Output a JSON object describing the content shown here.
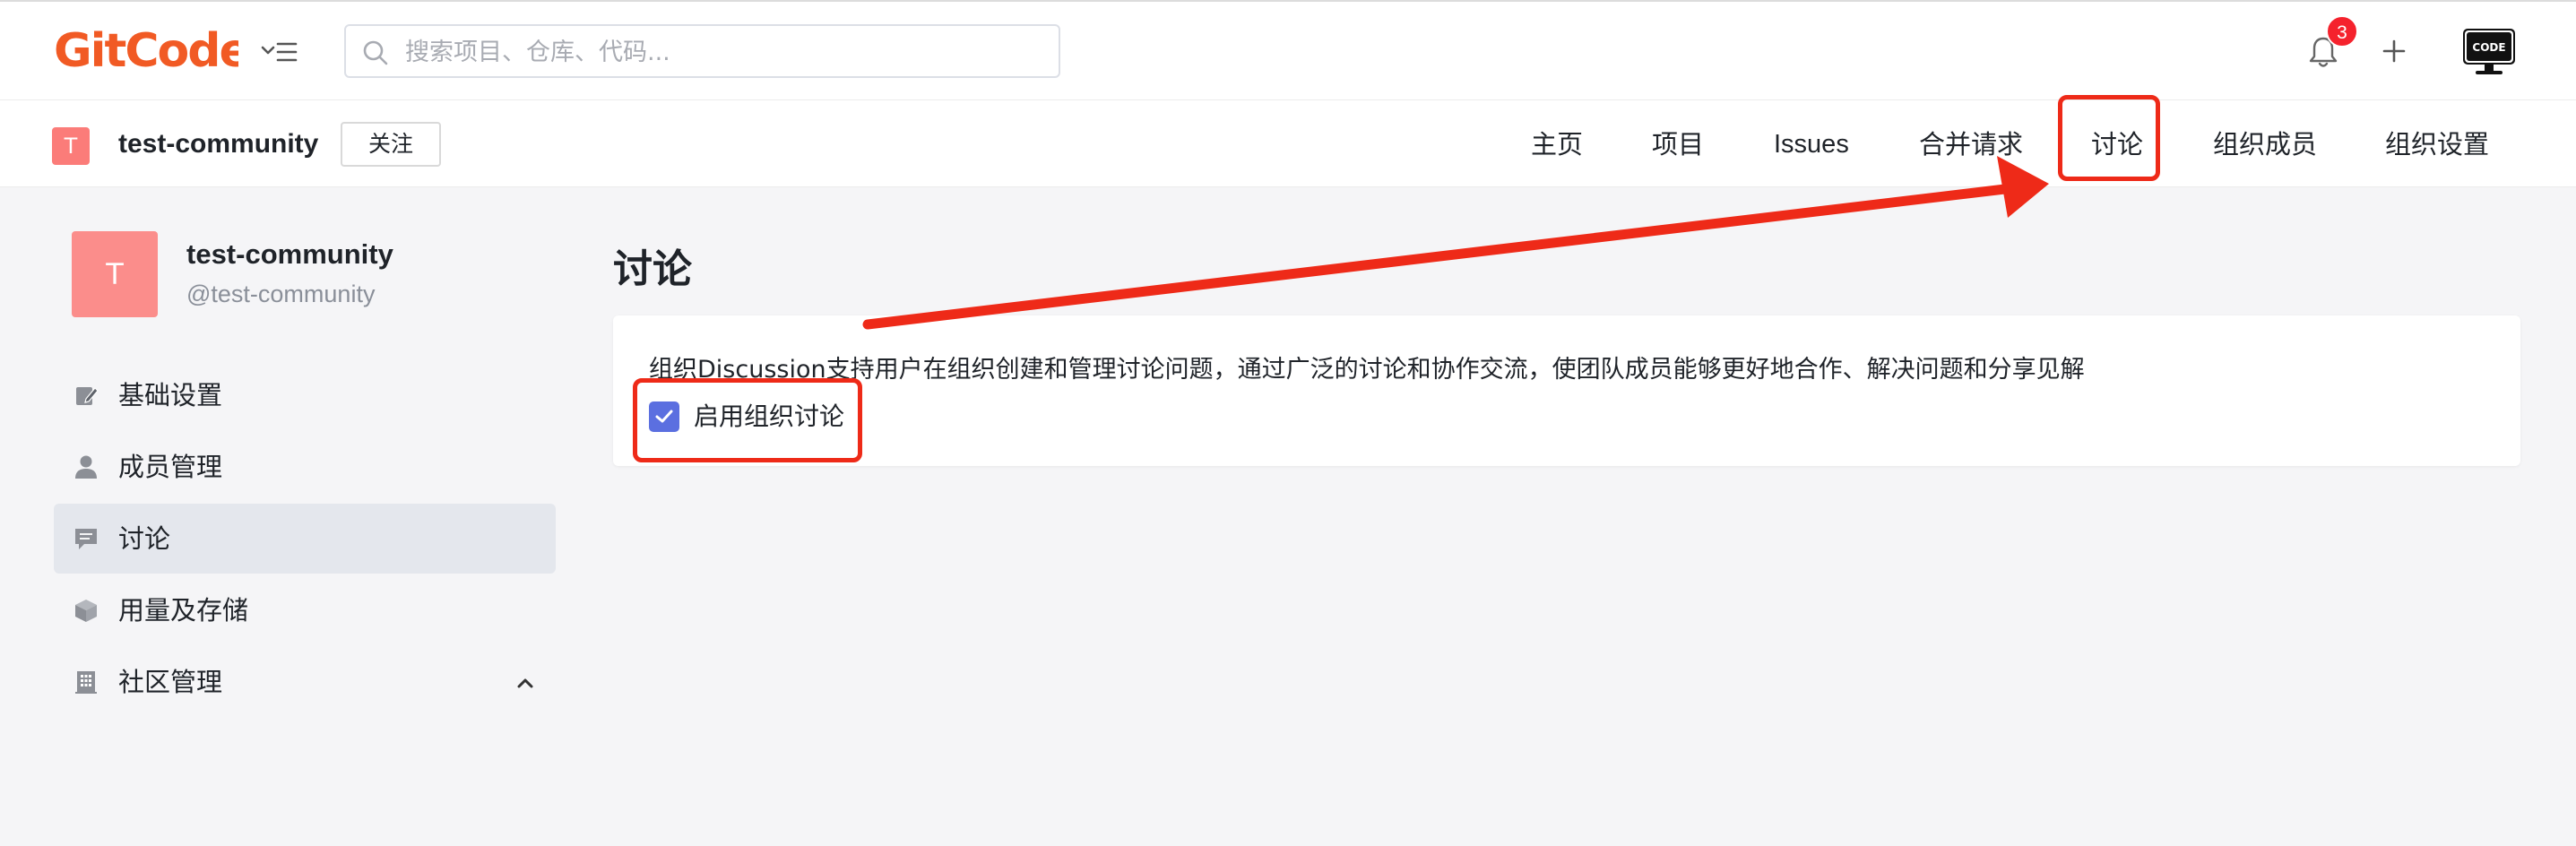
{
  "header": {
    "logo_text": "GitCode",
    "search": {
      "placeholder": "搜索项目、仓库、代码..."
    },
    "notifications": {
      "count": "3"
    },
    "avatar_text": "CODE"
  },
  "org_bar": {
    "badge_letter": "T",
    "name": "test-community",
    "follow_label": "关注",
    "tabs": [
      {
        "label": "主页"
      },
      {
        "label": "项目"
      },
      {
        "label": "Issues"
      },
      {
        "label": "合并请求"
      },
      {
        "label": "讨论"
      },
      {
        "label": "组织成员"
      },
      {
        "label": "组织设置"
      }
    ]
  },
  "sidebar": {
    "avatar_letter": "T",
    "title": "test-community",
    "handle": "@test-community",
    "items": [
      {
        "label": "基础设置",
        "icon": "edit-icon"
      },
      {
        "label": "成员管理",
        "icon": "user-icon"
      },
      {
        "label": "讨论",
        "icon": "chat-icon",
        "active": true
      },
      {
        "label": "用量及存储",
        "icon": "box-icon"
      },
      {
        "label": "社区管理",
        "icon": "building-icon",
        "expanded": true
      }
    ]
  },
  "main": {
    "title": "讨论",
    "description": "组织Discussion支持用户在组织创建和管理讨论问题，通过广泛的讨论和协作交流，使团队成员能够更好地合作、解决问题和分享见解",
    "enable_checkbox": {
      "label": "启用组织讨论",
      "checked": true
    }
  },
  "colors": {
    "brand": "#f15a24",
    "annotation": "#ee2a18",
    "checkbox": "#5b6fe0",
    "badge": "#f5222d"
  }
}
